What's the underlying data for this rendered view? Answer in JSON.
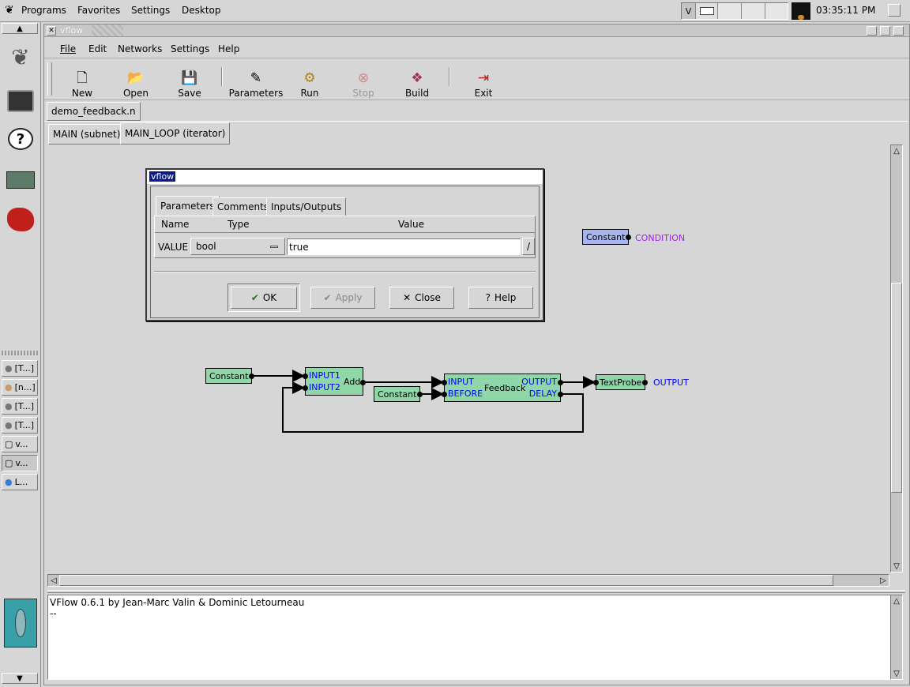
{
  "topbar": {
    "menus": [
      "Programs",
      "Favorites",
      "Settings",
      "Desktop"
    ],
    "clock": "03:35:11 PM",
    "workspace_label": "V"
  },
  "leftpanel": {
    "tasks": [
      "[T...]",
      "[n...]",
      "[T...]",
      "[T...]",
      "v...",
      "v...",
      "L..."
    ]
  },
  "window": {
    "title": "vflow",
    "menus": [
      "File",
      "Edit",
      "Networks",
      "Settings",
      "Help"
    ],
    "toolbar": {
      "new": "New",
      "open": "Open",
      "save": "Save",
      "parameters": "Parameters",
      "run": "Run",
      "stop": "Stop",
      "build": "Build",
      "exit": "Exit"
    },
    "file_tab": "demo_feedback.n",
    "net_tabs": [
      "MAIN (subnet)",
      "MAIN_LOOP (iterator)"
    ]
  },
  "network": {
    "nodes": {
      "constant_condition": "Constant",
      "condition_label": "CONDITION",
      "constant1": "Constant",
      "add": "Add",
      "add_in1": "INPUT1",
      "add_in2": "INPUT2",
      "constant2": "Constant",
      "feedback": "Feedback",
      "fb_input": "INPUT",
      "fb_before": "BEFORE",
      "fb_output": "OUTPUT",
      "fb_delay": "DELAY",
      "textprobe": "TextProbe",
      "output_label": "OUTPUT"
    }
  },
  "dialog": {
    "title": "vflow",
    "tabs": [
      "Parameters",
      "Comments",
      "Inputs/Outputs"
    ],
    "columns": [
      "Name",
      "Type",
      "Value"
    ],
    "param_name": "VALUE",
    "param_type": "bool",
    "param_value": "true",
    "value_btn": "/",
    "buttons": {
      "ok": "OK",
      "apply": "Apply",
      "close": "Close",
      "help": "Help"
    }
  },
  "console": {
    "line1": "VFlow 0.6.1 by Jean-Marc Valin & Dominic Letourneau",
    "line2": "--"
  },
  "colors": {
    "node": "#8fd6a8",
    "node_selected": "#a8b4ee",
    "port_label": "#0000ff",
    "condition": "#a020f0"
  }
}
